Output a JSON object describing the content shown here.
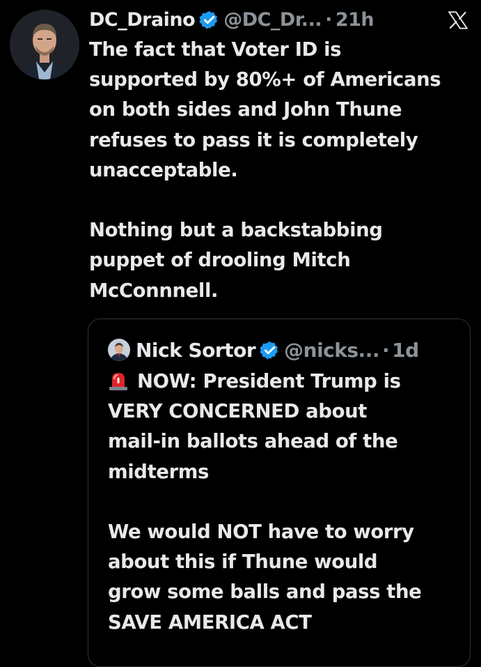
{
  "tweet": {
    "author_name": "DC_Draino",
    "handle": "@DC_Dr...",
    "separator": "·",
    "time": "21h",
    "text": "The fact that Voter ID is\nsupported by 80%+ of Americans\non both sides and John Thune\nrefuses to pass it is completely\nunacceptable.\n\nNothing but a backstabbing\npuppet of drooling Mitch\nMcConnnell."
  },
  "quoted_tweet": {
    "author_name": "Nick Sortor",
    "handle": "@nicks...",
    "separator": "·",
    "time": "1d",
    "text_first_line": "NOW: President Trump is",
    "text_rest": "VERY CONCERNED about\nmail-in ballots ahead of the\nmidterms\n\nWe would NOT have to worry\nabout this if Thune would\ngrow some balls and pass the\nSAVE AMERICA ACT"
  },
  "colors": {
    "background": "#000000",
    "text_primary": "#e7e9ea",
    "text_secondary": "#8b9298",
    "verified_badge": "#1d9bf0",
    "quote_border": "#2f3336"
  },
  "icons": {
    "verified": "verified-badge-icon",
    "x_logo": "x-logo-icon",
    "siren": "rotating-light-emoji-icon"
  }
}
